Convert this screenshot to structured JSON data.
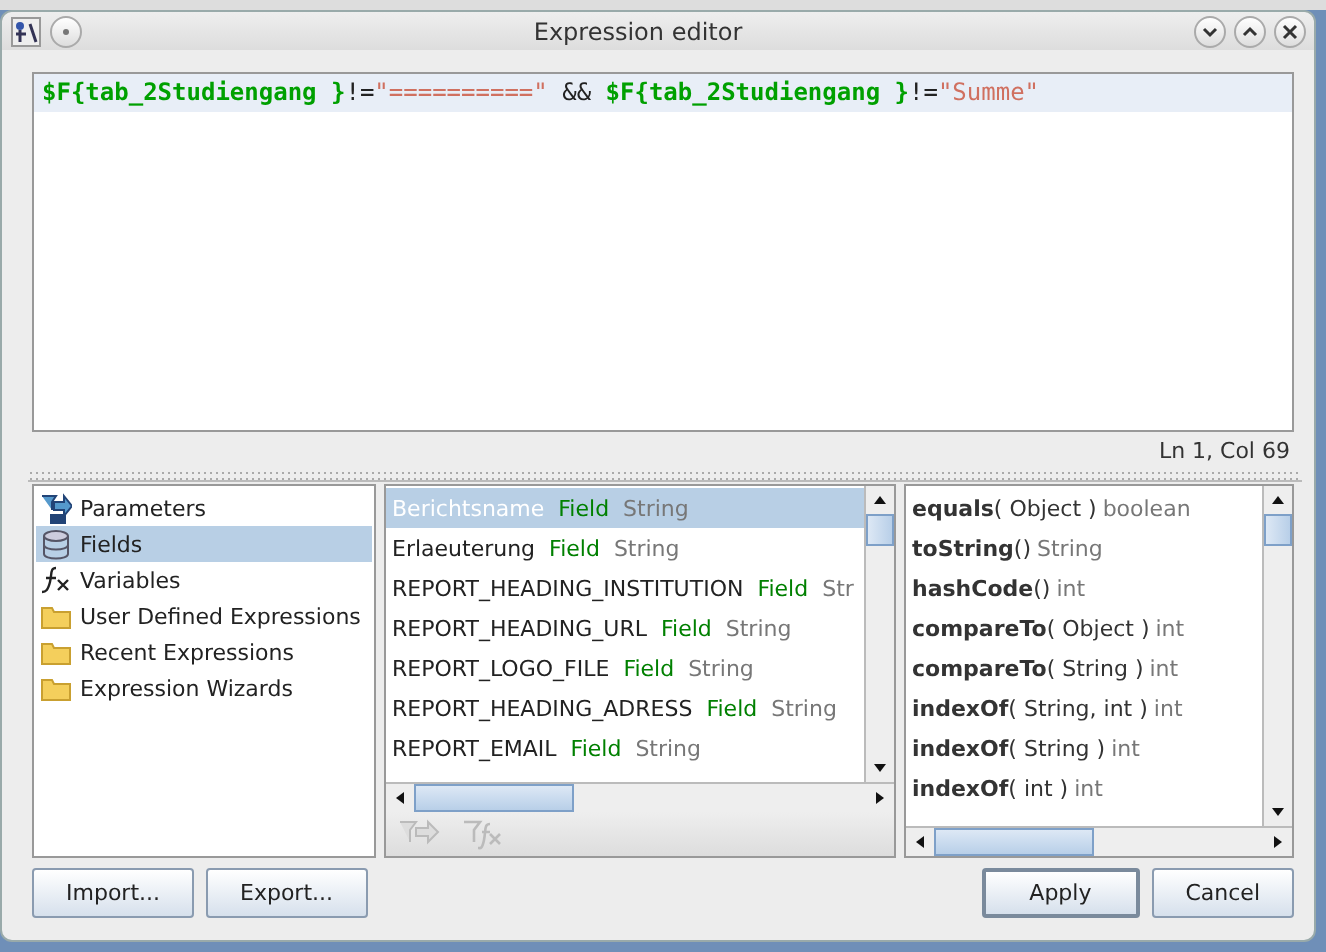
{
  "window": {
    "title": "Expression editor"
  },
  "expression": [
    {
      "kind": "field",
      "text": "$F{tab_2Studiengang }"
    },
    {
      "kind": "op",
      "text": "!="
    },
    {
      "kind": "string",
      "text": "\"==========\""
    },
    {
      "kind": "op",
      "text": " && "
    },
    {
      "kind": "field",
      "text": "$F{tab_2Studiengang }"
    },
    {
      "kind": "op",
      "text": "!="
    },
    {
      "kind": "string",
      "text": "\"Summe\""
    }
  ],
  "cursor_position": "Ln 1, Col 69",
  "categories": [
    {
      "label": "Parameters",
      "selected": false
    },
    {
      "label": "Fields",
      "selected": true
    },
    {
      "label": "Variables",
      "selected": false
    },
    {
      "label": "User Defined Expressions",
      "selected": false
    },
    {
      "label": "Recent Expressions",
      "selected": false
    },
    {
      "label": "Expression Wizards",
      "selected": false
    }
  ],
  "fields": [
    {
      "name": "Berichtsname",
      "kind": "Field",
      "type": "String",
      "selected": true
    },
    {
      "name": "Erlaeuterung",
      "kind": "Field",
      "type": "String",
      "selected": false
    },
    {
      "name": "REPORT_HEADING_INSTITUTION",
      "kind": "Field",
      "type": "Str",
      "selected": false
    },
    {
      "name": "REPORT_HEADING_URL",
      "kind": "Field",
      "type": "String",
      "selected": false
    },
    {
      "name": "REPORT_LOGO_FILE",
      "kind": "Field",
      "type": "String",
      "selected": false
    },
    {
      "name": "REPORT_HEADING_ADRESS",
      "kind": "Field",
      "type": "String",
      "selected": false
    },
    {
      "name": "REPORT_EMAIL",
      "kind": "Field",
      "type": "String",
      "selected": false
    }
  ],
  "methods": [
    {
      "name": "equals",
      "args": "( Object )",
      "returns": "boolean"
    },
    {
      "name": "toString",
      "args": "()",
      "returns": "String"
    },
    {
      "name": "hashCode",
      "args": "()",
      "returns": "int"
    },
    {
      "name": "compareTo",
      "args": "( Object )",
      "returns": "int"
    },
    {
      "name": "compareTo",
      "args": "( String )",
      "returns": "int"
    },
    {
      "name": "indexOf",
      "args": "( String, int )",
      "returns": "int"
    },
    {
      "name": "indexOf",
      "args": "( String )",
      "returns": "int"
    },
    {
      "name": "indexOf",
      "args": "( int )",
      "returns": "int"
    }
  ],
  "buttons_left": [
    "Import...",
    "Export..."
  ],
  "buttons_right": [
    {
      "label": "Apply",
      "default": true
    },
    {
      "label": "Cancel",
      "default": false
    }
  ]
}
